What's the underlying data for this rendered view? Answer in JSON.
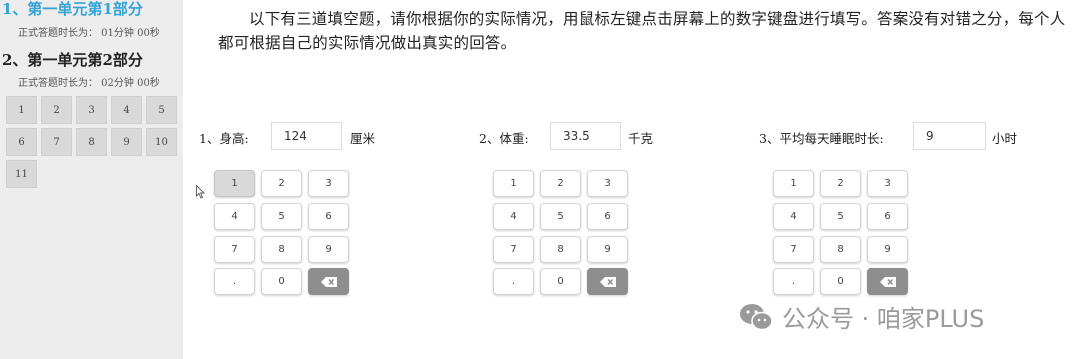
{
  "sidebar": {
    "sections": [
      {
        "title": "1、第一单元第1部分",
        "time": "正式答题时长为： 01分钟 00秒",
        "active": true
      },
      {
        "title": "2、第一单元第2部分",
        "time": "正式答题时长为： 02分钟 00秒",
        "active": false
      }
    ],
    "question_numbers": [
      "1",
      "2",
      "3",
      "4",
      "5",
      "6",
      "7",
      "8",
      "9",
      "10",
      "11"
    ]
  },
  "instructions": "以下有三道填空题，请你根据你的实际情况，用鼠标左键点击屏幕上的数字键盘进行填写。答案没有对错之分，每个人都可根据自己的实际情况做出真实的回答。",
  "questions": [
    {
      "label": "1、身高:",
      "value": "124",
      "unit": "厘米"
    },
    {
      "label": "2、体重:",
      "value": "33.5",
      "unit": "千克"
    },
    {
      "label": "3、平均每天睡眠时长:",
      "value": "9",
      "unit": "小时"
    }
  ],
  "keypad": {
    "keys": [
      "1",
      "2",
      "3",
      "4",
      "5",
      "6",
      "7",
      "8",
      "9",
      ".",
      "0"
    ],
    "delete_icon": "backspace-icon",
    "pressed_key": "1"
  },
  "watermark": {
    "icon": "wechat-icon",
    "text": "公众号 · 咱家PLUS"
  },
  "colors": {
    "active_section": "#35a3d6",
    "sidebar_bg": "#ededed",
    "delete_key": "#8e8e8e"
  }
}
